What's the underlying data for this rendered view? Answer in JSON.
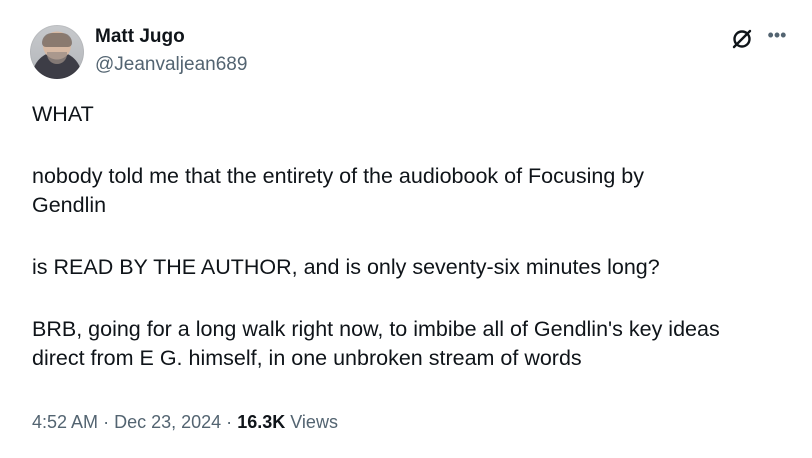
{
  "author": {
    "name": "Matt Jugo",
    "handle": "@Jeanvaljean689"
  },
  "icons": {
    "grok": "grok-icon",
    "more": "more-options-icon"
  },
  "tweet": {
    "paragraphs": [
      [
        "WHAT"
      ],
      [
        "nobody told me that the entirety of the audiobook of Focusing by",
        "Gendlin"
      ],
      [
        "is READ BY THE AUTHOR, and is only seventy-six minutes long?"
      ],
      [
        "BRB, going for a long walk right now, to imbibe all of Gendlin's key ideas",
        "direct from E G. himself, in one unbroken stream of words"
      ]
    ]
  },
  "meta": {
    "time": "4:52 AM",
    "separator": "·",
    "date": "Dec 23, 2024",
    "views_count": "16.3K",
    "views_label": "Views"
  }
}
